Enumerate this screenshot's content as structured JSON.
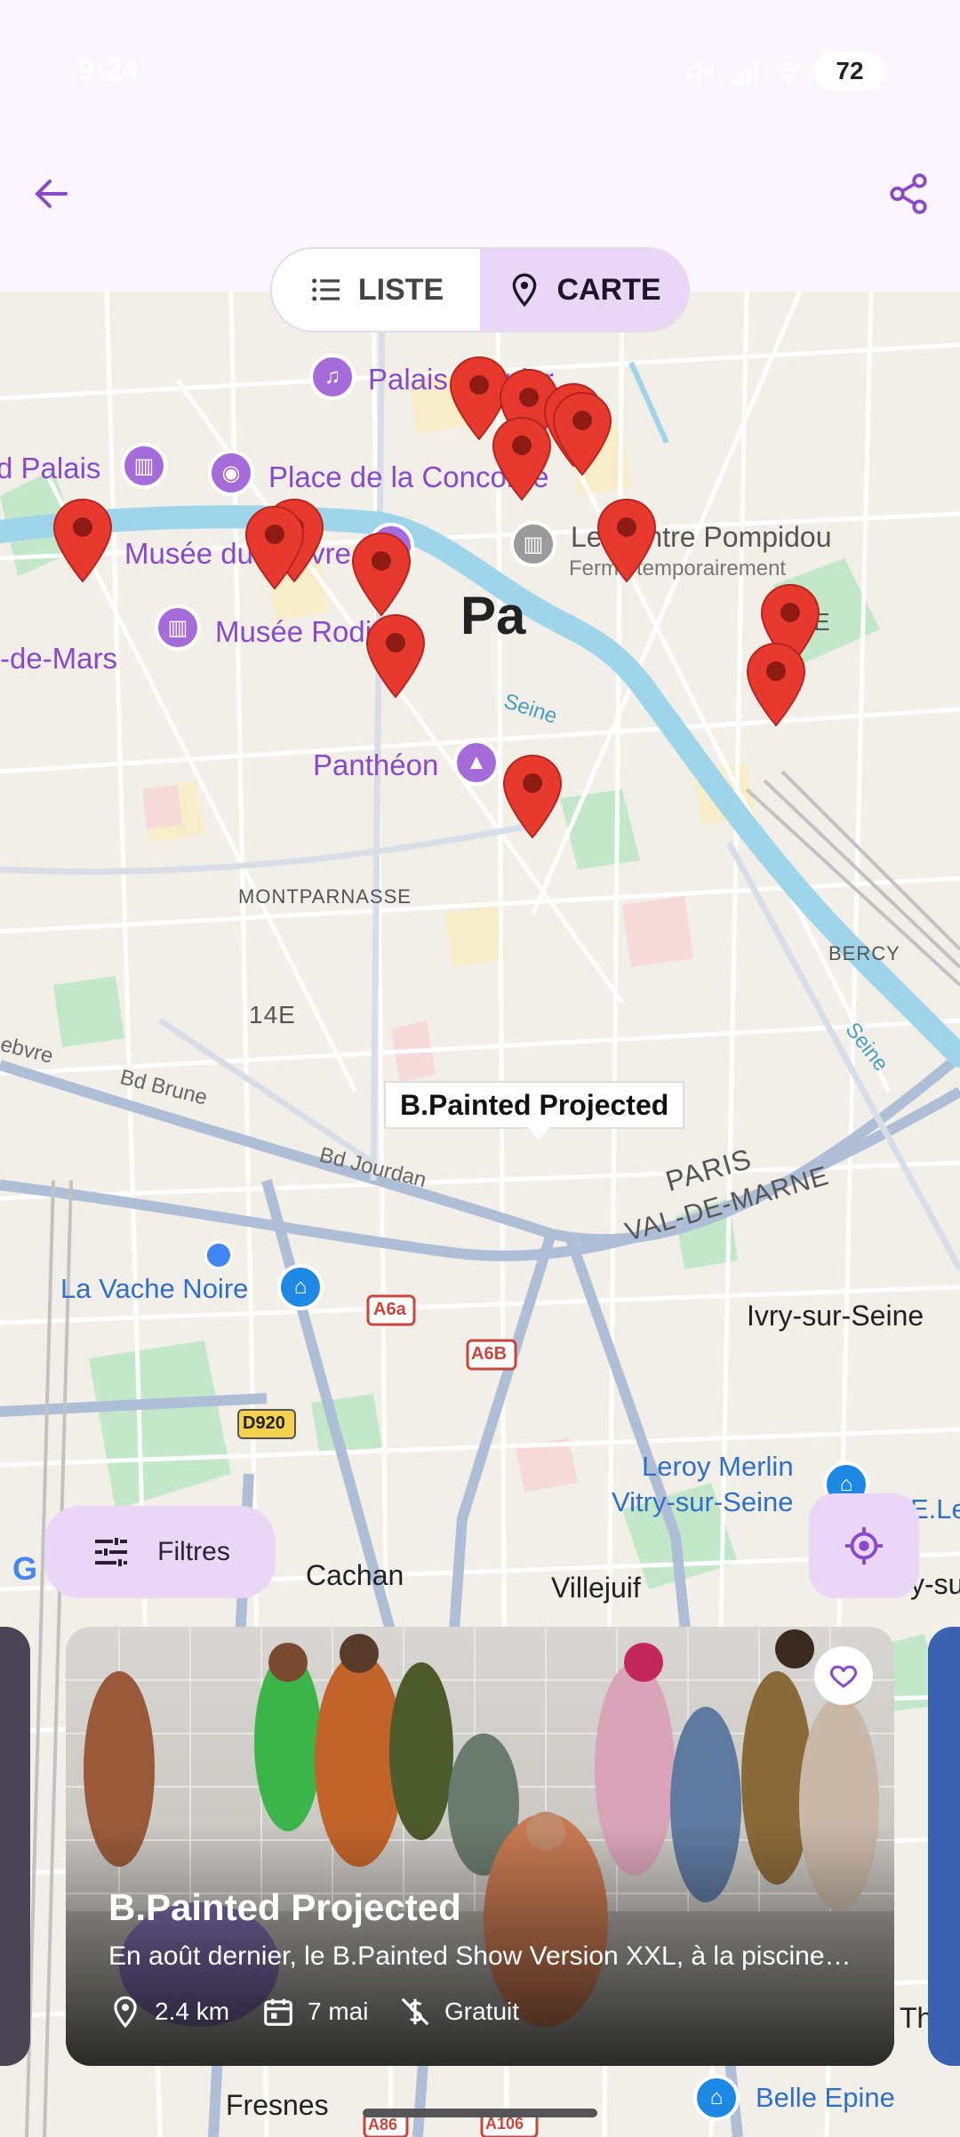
{
  "status_bar": {
    "time": "9:24",
    "battery": "72"
  },
  "app_bar": {
    "back_icon": "arrow-back-icon",
    "share_icon": "share-icon"
  },
  "view_toggle": {
    "list_label": "LISTE",
    "map_label": "CARTE",
    "selected": "CARTE",
    "list_icon": "list-icon",
    "map_icon": "map-pin-icon"
  },
  "map": {
    "poi": {
      "palais_garnier": "Palais Garnier",
      "place_concorde": "Place de la Concorde",
      "grand_palais": "d Palais",
      "louvre": "Musée du Louvre",
      "pompidou": "Le Centre Pompidou",
      "pompidou_status": "Fermé temporairement",
      "rodin": "Musée Rodin",
      "champ_de_mars": "-de-Mars",
      "pantheon": "Panthéon",
      "vache_noire": "La Vache Noire",
      "leroy_merlin_1": "Leroy Merlin",
      "leroy_merlin_2": "Vitry-sur-Seine",
      "belle_epine": "Belle Epine",
      "e_leclerc": "E.Le"
    },
    "areas": {
      "paris_center": "Pa",
      "district_11": "11E",
      "district_14": "14E",
      "montparnasse": "MONTPARNASSE",
      "bercy": "BERCY",
      "paris_border": "PARIS",
      "val_de_marne": "VAL-DE-MARNE",
      "ivry": "Ivry-sur-Seine",
      "cachan": "Cachan",
      "villejuif": "Villejuif",
      "fresnes": "Fresnes",
      "vitry_edge": "y-su",
      "the_edge": "Th"
    },
    "roads": {
      "bd_brune": "Bd Brune",
      "bd_jourdan": "Bd Jourdan",
      "seine_1": "Seine",
      "seine_2": "Seine",
      "a6a": "A6a",
      "a6b": "A6B",
      "d920": "D920",
      "a86": "A86",
      "a106": "A106",
      "ebvre": "ebvre"
    },
    "selected_marker_label": "B.Painted Projected",
    "google_logo": "G"
  },
  "filters": {
    "label": "Filtres",
    "icon": "tune-icon"
  },
  "locate_icon": "my-location-icon",
  "event_card": {
    "title": "B.Painted Projected",
    "description": "En août dernier, le B.Painted Show Version XXL, à la piscine…",
    "distance": "2.4 km",
    "date": "7 mai",
    "price": "Gratuit",
    "favorite_icon": "heart-outline-icon"
  },
  "colors": {
    "accent": "#8a49c9",
    "accent_container": "#ead7f7",
    "app_bar_bg": "#fbf6fd",
    "marker_red": "#e8392f",
    "water": "#9fd5ea",
    "park": "#bfe6c6"
  }
}
